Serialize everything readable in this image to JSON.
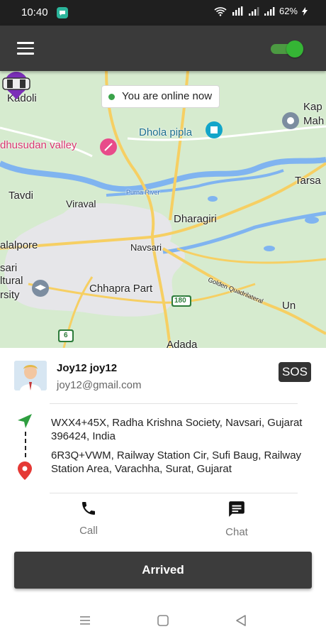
{
  "status_bar": {
    "time": "10:40",
    "battery": "62%"
  },
  "app_bar": {
    "menu_icon": "hamburger-menu-icon",
    "online_toggle_on": true,
    "accent_color": "#35b535"
  },
  "map": {
    "status_pill": "You are online now",
    "place_labels": [
      "Kadoli",
      "Kap",
      "Mah",
      "Dhola pipla",
      "dhusudan valley",
      "Tavdi",
      "Tarsa",
      "Viraval",
      "Purna River",
      "Dharagiri",
      "alalpore",
      "Navsari",
      "sari",
      "ltural",
      "rsity",
      "Chhapra Part",
      "Golden Quadrilateral",
      "Un",
      "Adada"
    ],
    "road_shields": [
      "180",
      "6"
    ]
  },
  "rider": {
    "name": "Joy12 joy12",
    "email": "joy12@gmail.com",
    "sos_label": "SOS"
  },
  "trip": {
    "pickup": "WXX4+45X, Radha Krishna Society, Navsari, Gujarat 396424, India",
    "dropoff": "6R3Q+VWM, Railway Station Cir, Sufi Baug, Railway Station Area, Varachha, Surat, Gujarat"
  },
  "actions": {
    "call_label": "Call",
    "chat_label": "Chat"
  },
  "primary_button": {
    "label": "Arrived"
  },
  "colors": {
    "pickup_arrow": "#2e9e3f",
    "dropoff_pin": "#e53935",
    "button_bg": "#3c3c3c"
  }
}
